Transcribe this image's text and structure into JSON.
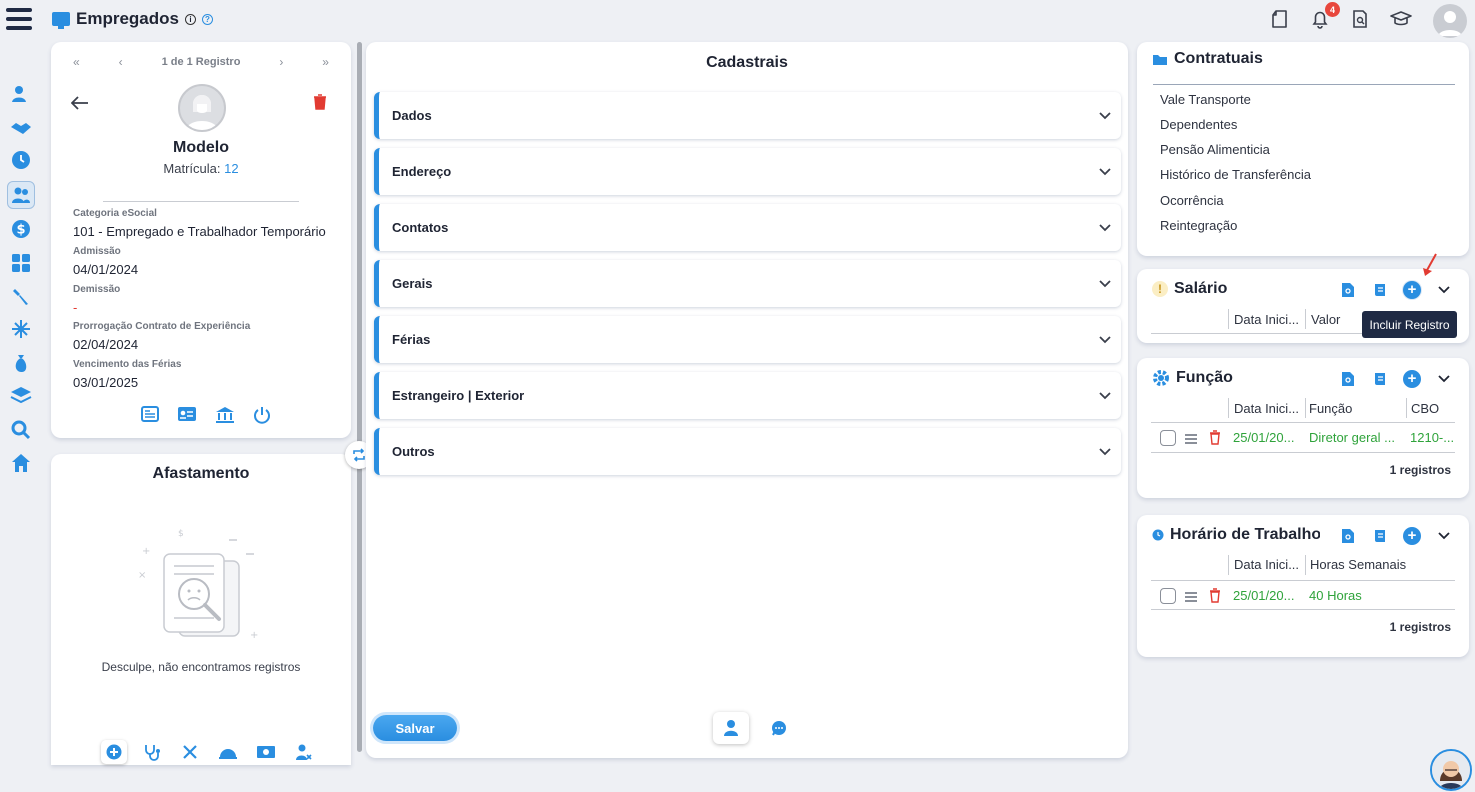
{
  "app": {
    "title": "Empregados",
    "notification_count": "4"
  },
  "employee": {
    "pager_label": "1 de 1 Registro",
    "name": "Modelo",
    "matricula_label": "Matrícula:",
    "matricula_value": "12",
    "fields": [
      {
        "label": "Categoria eSocial",
        "value": "101 - Empregado e Trabalhador Temporário"
      },
      {
        "label": "Admissão",
        "value": "04/01/2024"
      },
      {
        "label": "Demissão",
        "value": "-"
      },
      {
        "label": "Prorrogação Contrato de Experiência",
        "value": "02/04/2024"
      },
      {
        "label": "Vencimento das Férias",
        "value": "03/01/2025"
      }
    ]
  },
  "afastamento": {
    "title": "Afastamento",
    "empty_text": "Desculpe, não encontramos registros"
  },
  "cadastrais": {
    "title": "Cadastrais",
    "sections": [
      "Dados",
      "Endereço",
      "Contatos",
      "Gerais",
      "Férias",
      "Estrangeiro | Exterior",
      "Outros"
    ],
    "save_label": "Salvar"
  },
  "contratuais": {
    "title": "Contratuais",
    "items": [
      "Vale Transporte",
      "Dependentes",
      "Pensão Alimenticia",
      "Histórico de Transferência",
      "Ocorrência",
      "Reintegração"
    ]
  },
  "salario": {
    "title": "Salário",
    "columns": [
      "Data Inici...",
      "Valor"
    ],
    "tooltip": "Incluir Registro"
  },
  "funcao": {
    "title": "Função",
    "columns": [
      "Data Inici...",
      "Função",
      "CBO"
    ],
    "rows": [
      {
        "data": "25/01/20...",
        "funcao": "Diretor geral ...",
        "cbo": "1210-..."
      }
    ],
    "count": "1 registros"
  },
  "horario": {
    "title": "Horário de Trabalho",
    "columns": [
      "Data Inici...",
      "Horas Semanais"
    ],
    "rows": [
      {
        "data": "25/01/20...",
        "horas": "40 Horas"
      }
    ],
    "count": "1 registros"
  },
  "colors": {
    "accent": "#2a8ee0",
    "danger": "#e23b32",
    "success": "#2fa33b",
    "dark": "#1f2a44"
  }
}
